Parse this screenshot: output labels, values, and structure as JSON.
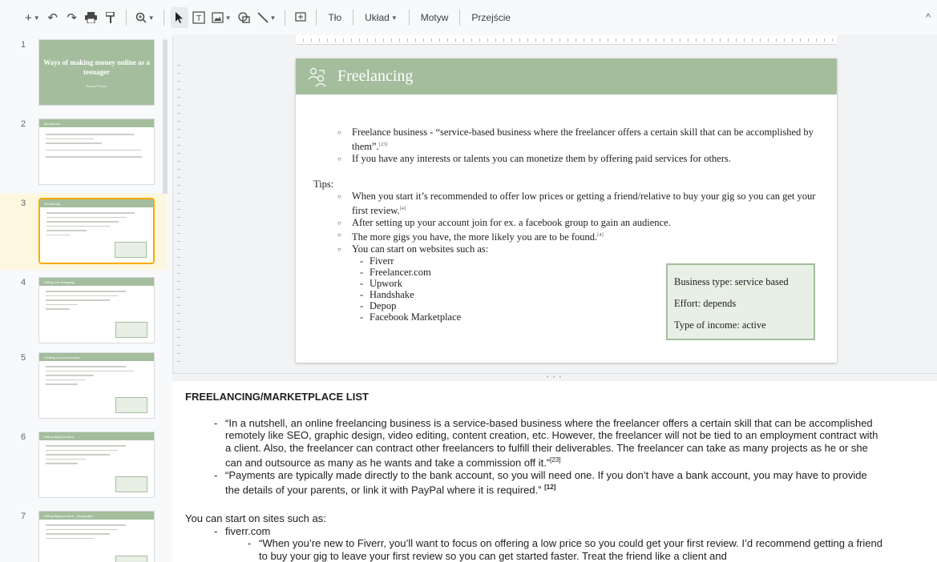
{
  "toolbar": {
    "background_label": "Tło",
    "layout_label": "Układ",
    "theme_label": "Motyw",
    "transition_label": "Przejście"
  },
  "filmstrip": {
    "slides": [
      {
        "num": "1",
        "title": "Ways of making money online as a teenager",
        "subtitle": "Personal Project"
      },
      {
        "num": "2",
        "title": "Introduction"
      },
      {
        "num": "3",
        "title": "Freelancing"
      },
      {
        "num": "4",
        "title": "Selling your belongings"
      },
      {
        "num": "5",
        "title": "Creating your own business"
      },
      {
        "num": "6",
        "title": "Selling digital products"
      },
      {
        "num": "7",
        "title": "Selling digital products - photography"
      }
    ]
  },
  "slide": {
    "title": "Freelancing",
    "bullets": [
      {
        "text": "Freelance business - “service-based business where the freelancer offers a certain skill that can be accomplished by them”.",
        "ref": "[23]"
      },
      {
        "text": "If you have any interests or talents you can monetize them by offering paid services for others.",
        "ref": ""
      }
    ],
    "tips_label": "Tips:",
    "tips": [
      {
        "text": "When you start it’s recommended to offer low prices or getting a friend/relative to buy your gig so you can get your first review.",
        "ref": "[4]"
      },
      {
        "text": "After setting up your account join for ex. a facebook group to gain an audience.",
        "ref": ""
      },
      {
        "text": "The more gigs you have, the more likely you are to be found.",
        "ref": "[4]"
      },
      {
        "text": "You can start on websites such as:",
        "ref": ""
      }
    ],
    "websites": [
      "Fiverr",
      "Freelancer.com",
      "Upwork",
      "Handshake",
      "Depop",
      "Facebook Marketplace"
    ],
    "info_box": {
      "business_type": "Business type: service based",
      "effort": "Effort: depends",
      "income": "Type of income: active"
    }
  },
  "notes": {
    "heading": "FREELANCING/MARKETPLACE LIST",
    "items": [
      {
        "text": "“In a nutshell, an online freelancing business is a service-based business where the freelancer offers a certain skill that can be accomplished remotely like SEO, graphic design, video editing, content creation, etc. However, the freelancer will not be tied to an employment contract with a client. Also, the freelancer can contract other freelancers to fulfill their deliverables. The freelancer can take as many projects as he or she can and outsource as many as he wants and take a commission off it.”",
        "ref": "[23]"
      },
      {
        "text": "“Payments are typically made directly to the bank account, so you will need one. If you don’t have a bank account, you may have to provide the details of your parents, or link it with PayPal where it is required.”",
        "ref": "[12]"
      }
    ],
    "sites_heading": "You can start on sites such as:",
    "site1": "fiverr.com",
    "site1_quote": "“When you’re new to Fiverr, you’ll want to focus on offering a low price so you could get your first review. I’d recommend getting a friend to buy your gig to leave your first review so you can get started faster. Treat the friend like a client and"
  },
  "colors": {
    "accent_green": "#a4bd9d",
    "box_fill": "#e8efe5",
    "selected_border": "#f9ab00"
  }
}
